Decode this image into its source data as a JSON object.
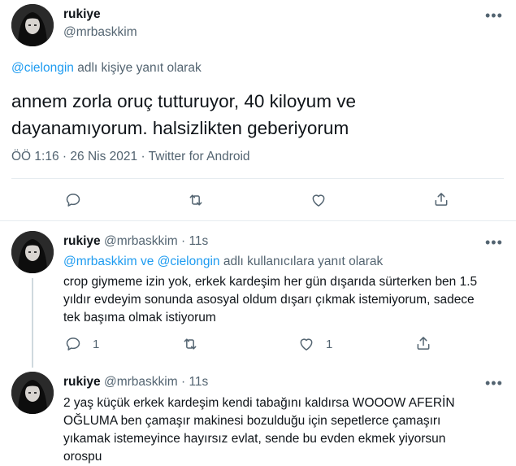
{
  "main_tweet": {
    "name": "rukiye",
    "handle": "@mrbaskkim",
    "reply_to_user": "@cielongin",
    "reply_to_suffix": " adlı kişiye yanıt olarak",
    "text_line1": "annem zorla oruç tutturuyor, 40 kiloyum ve",
    "text_line2": "dayanamıyorum. halsizlikten geberiyorum",
    "time": "ÖÖ 1:16",
    "date": "26 Nis 2021",
    "source": "Twitter for Android",
    "dot": "·"
  },
  "reply1": {
    "name": "rukiye",
    "handle": "@mrbaskkim",
    "time_ago": "11s",
    "reply_users": "@mrbaskkim ve @cielongin",
    "reply_suffix": " adlı kullanıcılara yanıt olarak",
    "text_line1": "crop giymeme izin yok, erkek kardeşim her gün dışarıda sürterken ben 1.5",
    "text_line2": "yıldır evdeyim sonunda asosyal oldum dışarı çıkmak istemiyorum, sadece",
    "text_line3": "tek başıma olmak istiyorum",
    "reply_count": "1",
    "like_count": "1"
  },
  "reply2": {
    "name": "rukiye",
    "handle": "@mrbaskkim",
    "time_ago": "11s",
    "text_line1": "2 yaş küçük erkek kardeşim kendi tabağını kaldırsa WOOOW AFERİN",
    "text_line2": "OĞLUMA ben çamaşır makinesi bozulduğu için sepetlerce çamaşırı",
    "text_line3": "yıkamak istemeyince hayırsız evlat, sende bu evden ekmek yiyorsun",
    "text_line4": "orospu"
  },
  "more_glyph": "•••",
  "colors": {
    "link": "#1d9bf0",
    "secondary": "#536471",
    "divider": "#e6ecf0"
  }
}
